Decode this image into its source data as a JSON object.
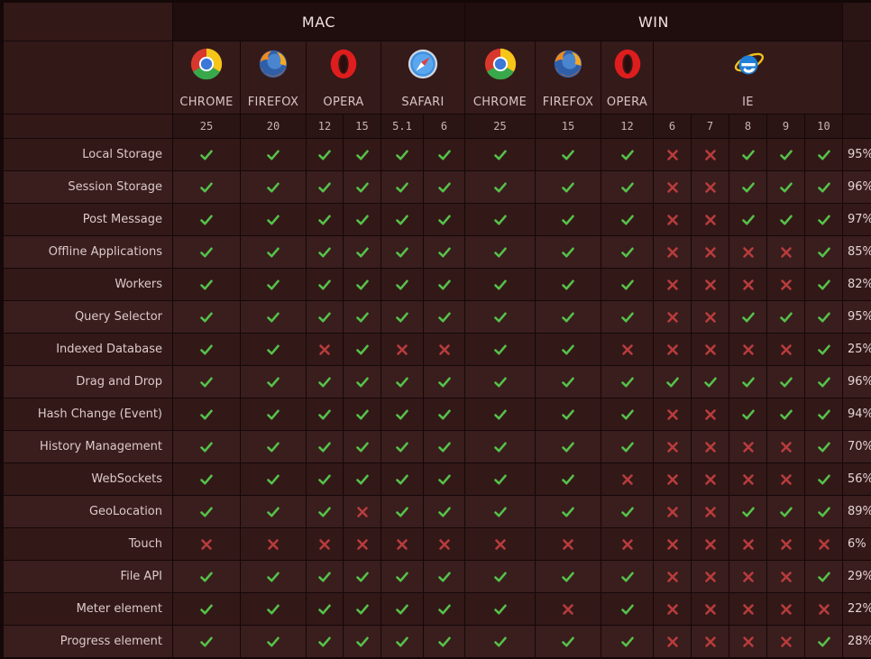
{
  "platforms": [
    {
      "name": "MAC",
      "col": 2,
      "span": 6
    },
    {
      "name": "WIN",
      "col": 8,
      "span": 8
    }
  ],
  "browsers": [
    {
      "name": "CHROME",
      "icon": "chrome-icon",
      "col": 2,
      "span": 1
    },
    {
      "name": "FIREFOX",
      "icon": "firefox-icon",
      "col": 3,
      "span": 1
    },
    {
      "name": "OPERA",
      "icon": "opera-icon",
      "col": 4,
      "span": 2
    },
    {
      "name": "SAFARI",
      "icon": "safari-icon",
      "col": 6,
      "span": 2
    },
    {
      "name": "CHROME",
      "icon": "chrome-icon",
      "col": 8,
      "span": 1
    },
    {
      "name": "FIREFOX",
      "icon": "firefox-icon",
      "col": 9,
      "span": 1
    },
    {
      "name": "OPERA",
      "icon": "opera-icon",
      "col": 10,
      "span": 1
    },
    {
      "name": "IE",
      "icon": "ie-icon",
      "col": 11,
      "span": 5
    }
  ],
  "versions": [
    "25",
    "20",
    "12",
    "15",
    "5.1",
    "6",
    "25",
    "15",
    "12",
    "6",
    "7",
    "8",
    "9",
    "10"
  ],
  "colors": {
    "check": "#55c14a",
    "cross": "#b83c3c"
  },
  "features": [
    {
      "name": "Local Storage",
      "support": "YYYYYYYYYNNYYY",
      "pct": "95%"
    },
    {
      "name": "Session Storage",
      "support": "YYYYYYYYYNNYYY",
      "pct": "96%"
    },
    {
      "name": "Post Message",
      "support": "YYYYYYYYYNNYYY",
      "pct": "97%"
    },
    {
      "name": "Offline Applications",
      "support": "YYYYYYYYYNNNNY",
      "pct": "85%"
    },
    {
      "name": "Workers",
      "support": "YYYYYYYYYNNNNY",
      "pct": "82%"
    },
    {
      "name": "Query Selector",
      "support": "YYYYYYYYYNNYYY",
      "pct": "95%"
    },
    {
      "name": "Indexed Database",
      "support": "YYNYNNYYNNNNNY",
      "pct": "25%"
    },
    {
      "name": "Drag and Drop",
      "support": "YYYYYYYYYYYYYY",
      "pct": "96%"
    },
    {
      "name": "Hash Change (Event)",
      "support": "YYYYYYYYYNNYYY",
      "pct": "94%"
    },
    {
      "name": "History Management",
      "support": "YYYYYYYYYNNNNY",
      "pct": "70%"
    },
    {
      "name": "WebSockets",
      "support": "YYYYYYYYNNNNNY",
      "pct": "56%"
    },
    {
      "name": "GeoLocation",
      "support": "YYYNYYYYYNNYYY",
      "pct": "89%"
    },
    {
      "name": "Touch",
      "support": "NNNNNNNNNNNNNN",
      "pct": "6%"
    },
    {
      "name": "File API",
      "support": "YYYYYYYYYNNNNY",
      "pct": "29%"
    },
    {
      "name": "Meter element",
      "support": "YYYYYYYNYNNNNN",
      "pct": "22%"
    },
    {
      "name": "Progress element",
      "support": "YYYYYYYYYNNNNY",
      "pct": "28%"
    }
  ]
}
